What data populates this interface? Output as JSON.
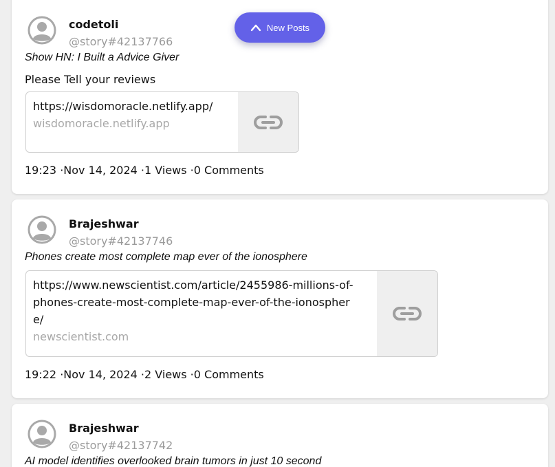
{
  "new_posts_button": {
    "label": "New Posts",
    "icon": "chevron-up-icon"
  },
  "colors": {
    "accent": "#6361e8",
    "card": "#ffffff",
    "background": "#efefef",
    "muted": "#9a9a9a"
  },
  "posts": [
    {
      "author": "codetoli",
      "handle": "@story#42137766",
      "title": "Show HN: I Built a Advice Giver",
      "body": "Please Tell your reviews",
      "link": {
        "url": "https://wisdomoracle.netlify.app/",
        "domain": "wisdomoracle.netlify.app"
      },
      "time": "19:23",
      "date": "Nov 14, 2024",
      "views": "1 Views",
      "comments": "0 Comments"
    },
    {
      "author": "Brajeshwar",
      "handle": "@story#42137746",
      "title": "Phones create most complete map ever of the ionosphere",
      "body": "",
      "link": {
        "url": "https://www.newscientist.com/article/2455986-millions-of-phones-create-most-complete-map-ever-of-the-ionosphere/",
        "domain": "newscientist.com"
      },
      "time": "19:22",
      "date": "Nov 14, 2024",
      "views": "2 Views",
      "comments": "0 Comments"
    },
    {
      "author": "Brajeshwar",
      "handle": "@story#42137742",
      "title": "AI model identifies overlooked brain tumors in just 10 second"
    }
  ]
}
